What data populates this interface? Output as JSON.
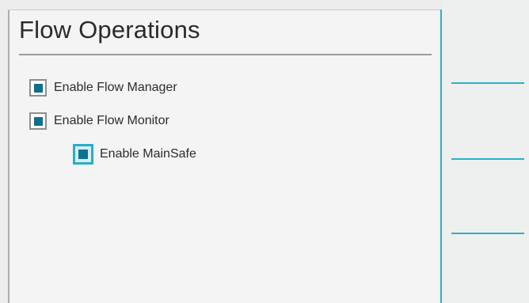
{
  "panel": {
    "title": "Flow Operations"
  },
  "options": [
    {
      "label": "Enable Flow Manager",
      "checked": true
    },
    {
      "label": "Enable Flow Monitor",
      "checked": true
    },
    {
      "label": "Enable MainSafe",
      "checked": true,
      "focused": true
    }
  ],
  "colors": {
    "accent": "#2bb1c9",
    "checkbox_fill": "#0e6e8d",
    "background": "#f3f4f3"
  }
}
